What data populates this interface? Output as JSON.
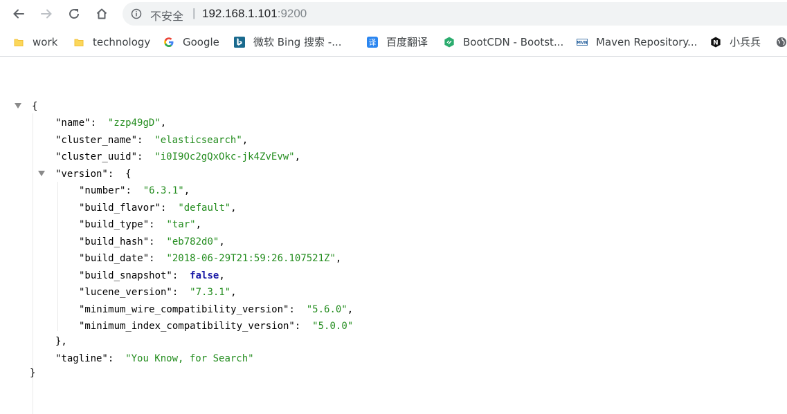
{
  "browser": {
    "address_bar": {
      "security_label": "不安全",
      "separator": "|",
      "host": "192.168.1.101",
      "port": ":9200"
    },
    "nav": {
      "back_icon": "back-arrow-icon",
      "forward_icon": "forward-arrow-icon",
      "reload_icon": "reload-icon",
      "home_icon": "home-icon"
    }
  },
  "bookmarks": [
    {
      "label": "work",
      "icon": "folder-icon"
    },
    {
      "label": "technology",
      "icon": "folder-icon"
    },
    {
      "label": "Google",
      "icon": "google-icon"
    },
    {
      "label": "微软 Bing 搜索 -...",
      "icon": "bing-icon"
    },
    {
      "label": "百度翻译",
      "icon": "baidu-translate-icon"
    },
    {
      "label": "BootCDN - Bootst...",
      "icon": "bootcdn-icon"
    },
    {
      "label": "Maven Repository...",
      "icon": "maven-icon"
    },
    {
      "label": "小兵兵",
      "icon": "n-icon"
    }
  ],
  "json": {
    "open_brace": "{",
    "close_brace": "}",
    "name_key": "\"name\"",
    "name_val": "\"zzp49gD\"",
    "cluster_name_key": "\"cluster_name\"",
    "cluster_name_val": "\"elasticsearch\"",
    "cluster_uuid_key": "\"cluster_uuid\"",
    "cluster_uuid_val": "\"i0I9Oc2gQxOkc-jk4ZvEvw\"",
    "version_key": "\"version\"",
    "version": {
      "number_key": "\"number\"",
      "number_val": "\"6.3.1\"",
      "build_flavor_key": "\"build_flavor\"",
      "build_flavor_val": "\"default\"",
      "build_type_key": "\"build_type\"",
      "build_type_val": "\"tar\"",
      "build_hash_key": "\"build_hash\"",
      "build_hash_val": "\"eb782d0\"",
      "build_date_key": "\"build_date\"",
      "build_date_val": "\"2018-06-29T21:59:26.107521Z\"",
      "build_snapshot_key": "\"build_snapshot\"",
      "build_snapshot_val": "false",
      "lucene_version_key": "\"lucene_version\"",
      "lucene_version_val": "\"7.3.1\"",
      "min_wire_key": "\"minimum_wire_compatibility_version\"",
      "min_wire_val": "\"5.6.0\"",
      "min_index_key": "\"minimum_index_compatibility_version\"",
      "min_index_val": "\"5.0.0\"",
      "close": "},"
    },
    "tagline_key": "\"tagline\"",
    "tagline_val": "\"You Know, for Search\""
  }
}
